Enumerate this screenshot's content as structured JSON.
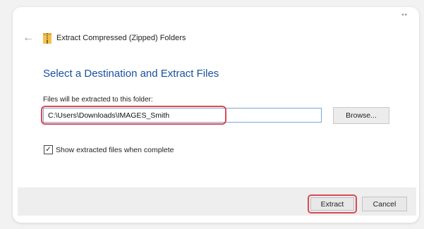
{
  "window": {
    "title": "Extract Compressed (Zipped) Folders",
    "heading": "Select a Destination and Extract Files"
  },
  "destination": {
    "label": "Files will be extracted to this folder:",
    "value": "C:\\Users\\Downloads\\IMAGES_Smith",
    "browse_label": "Browse..."
  },
  "options": {
    "show_files_label": "Show extracted files when complete",
    "show_files_checked": true
  },
  "footer": {
    "extract_label": "Extract",
    "cancel_label": "Cancel"
  },
  "colors": {
    "heading": "#1a4fa0",
    "highlight": "#d94a55",
    "input_border": "#7aa7d8"
  },
  "icons": {
    "back": "back-arrow-icon",
    "archive": "zip-folder-icon",
    "checkbox": "checkmark-icon"
  }
}
